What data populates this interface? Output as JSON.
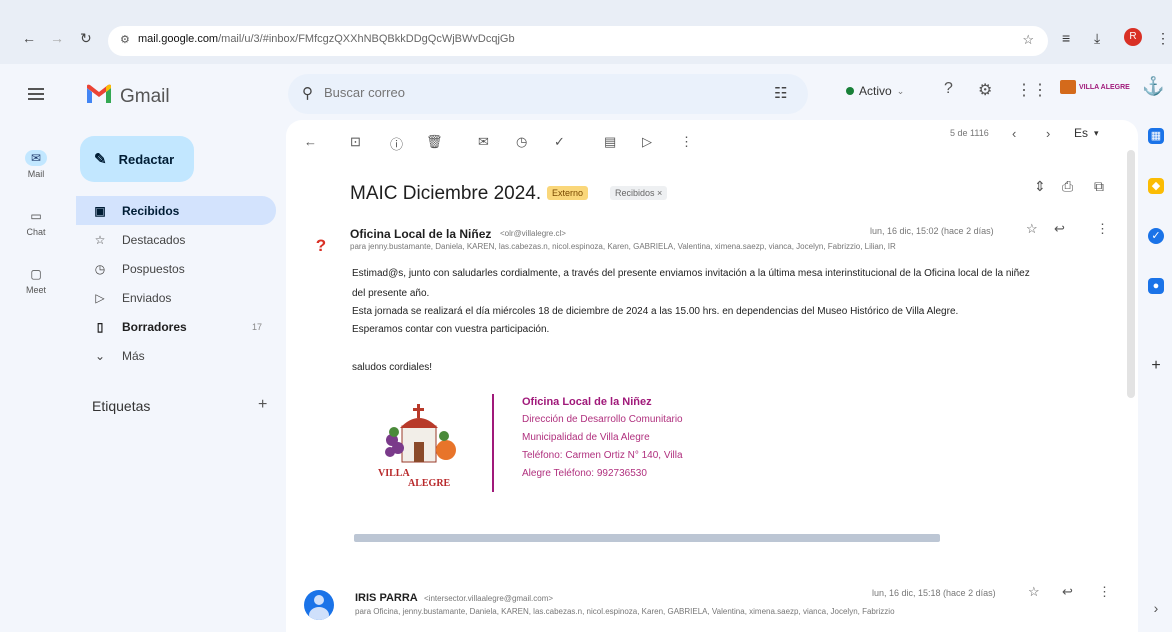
{
  "browser": {
    "url_host": "mail.google.com",
    "url_path": "/mail/u/3/#inbox/FMfcgzQXXhNBQBkkDDgQcWjBWvDcqjGb",
    "avatar_letter": "R"
  },
  "app": {
    "name": "Gmail"
  },
  "search": {
    "placeholder": "Buscar correo"
  },
  "status": {
    "label": "Activo"
  },
  "brand": {
    "name": "VILLA ALEGRE"
  },
  "rail": [
    {
      "label": "Mail"
    },
    {
      "label": "Chat"
    },
    {
      "label": "Meet"
    }
  ],
  "compose": {
    "label": "Redactar"
  },
  "nav": [
    {
      "label": "Recibidos",
      "count": ""
    },
    {
      "label": "Destacados",
      "count": ""
    },
    {
      "label": "Pospuestos",
      "count": ""
    },
    {
      "label": "Enviados",
      "count": ""
    },
    {
      "label": "Borradores",
      "count": "17"
    },
    {
      "label": "Más",
      "count": ""
    }
  ],
  "labels": {
    "heading": "Etiquetas"
  },
  "pager": {
    "text": "5 de 1116",
    "lang": "Es"
  },
  "thread": {
    "subject": "MAIC Diciembre 2024.",
    "badge_external": "Externo",
    "badge_inbox": "Recibidos ×"
  },
  "message1": {
    "sender": "Oficina Local de la Niñez",
    "email": "<olr@villalegre.cl>",
    "recipients": "para jenny.bustamante, Daniela, KAREN, las.cabezas.n, nicol.espinoza, Karen, GABRIELA, Valentina, ximena.saezp, vianca, Jocelyn, Fabrizzio, Lilian, IR",
    "date": "lun, 16 dic, 15:02 (hace 2 días)",
    "body": [
      "Estimad@s, junto con saludarles cordialmente, a través del presente enviamos invitación a la última mesa interinstitucional de la Oficina local de la niñez",
      "del presente año.",
      "Esta jornada se realizará el día miércoles 18 de diciembre de 2024 a las 15.00 hrs. en dependencias del Museo Histórico de Villa Alegre.",
      "Esperamos contar con vuestra participación.",
      "",
      "saludos cordiales!"
    ],
    "signature": {
      "title": "Oficina Local de la Niñez",
      "lines": [
        "Dirección de Desarrollo Comunitario",
        "Municipalidad de Villa Alegre",
        "Teléfono: Carmen Ortiz N° 140, Villa",
        "Alegre Teléfono: 992736530"
      ],
      "logo_text_1": "VILLA",
      "logo_text_2": "ALEGRE"
    }
  },
  "message2": {
    "sender": "IRIS PARRA",
    "email": "<intersector.villaalegre@gmail.com>",
    "recipients": "para Oficina, jenny.bustamante, Daniela, KAREN, las.cabezas.n, nicol.espinoza, Karen, GABRIELA, Valentina, ximena.saezp, vianca, Jocelyn, Fabrizzio",
    "date": "lun, 16 dic, 15:18 (hace 2 días)"
  },
  "colors": {
    "accent": "#c2e7ff",
    "nav_active": "#d3e3fd",
    "signature": "#a0197a",
    "external_badge": "#fad77a"
  }
}
